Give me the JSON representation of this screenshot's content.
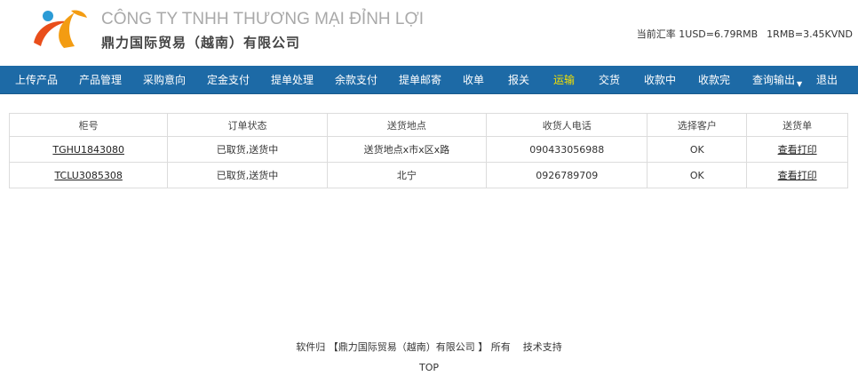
{
  "header": {
    "company_vn": "CÔNG TY TNHH THƯƠNG MẠI ĐỈNH LỢI",
    "company_cn": "鼎力国际贸易（越南）有限公司",
    "rate_usd": "当前汇率 1USD=6.79RMB",
    "rate_rmb": "1RMB=3.45KVND"
  },
  "colors": {
    "nav_bg": "#1d6aa6",
    "nav_active": "#f5e100",
    "logo_orange": "#f39c12",
    "logo_red": "#e94e1b",
    "logo_blue": "#2b9bd6"
  },
  "nav": {
    "items": [
      {
        "label": "上传产品"
      },
      {
        "label": "产品管理"
      },
      {
        "label": "采购意向"
      },
      {
        "label": "定金支付"
      },
      {
        "label": "提单处理"
      },
      {
        "label": "余款支付"
      },
      {
        "label": "提单邮寄"
      },
      {
        "label": "收单"
      },
      {
        "label": "报关"
      },
      {
        "label": "运输",
        "active": true
      },
      {
        "label": "交货"
      },
      {
        "label": "收款中"
      },
      {
        "label": "收款完"
      },
      {
        "label": "查询输出",
        "dropdown": true
      },
      {
        "label": "退出"
      }
    ]
  },
  "table": {
    "columns": [
      "柜号",
      "订单状态",
      "送货地点",
      "收货人电话",
      "选择客户",
      "送货单"
    ],
    "rows": [
      {
        "container": "TGHU1843080",
        "status": "已取货,送货中",
        "location": "送货地点x市x区x路",
        "phone": "090433056988",
        "customer": "OK",
        "action": "查看打印"
      },
      {
        "container": "TCLU3085308",
        "status": "已取货,送货中",
        "location": "北宁",
        "phone": "0926789709",
        "customer": "OK",
        "action": "查看打印"
      }
    ]
  },
  "footer": {
    "prefix": "软件归",
    "owner": "【鼎力国际贸易（越南）有限公司 】",
    "suffix": "所有",
    "support": "技术支持",
    "top": "TOP"
  }
}
